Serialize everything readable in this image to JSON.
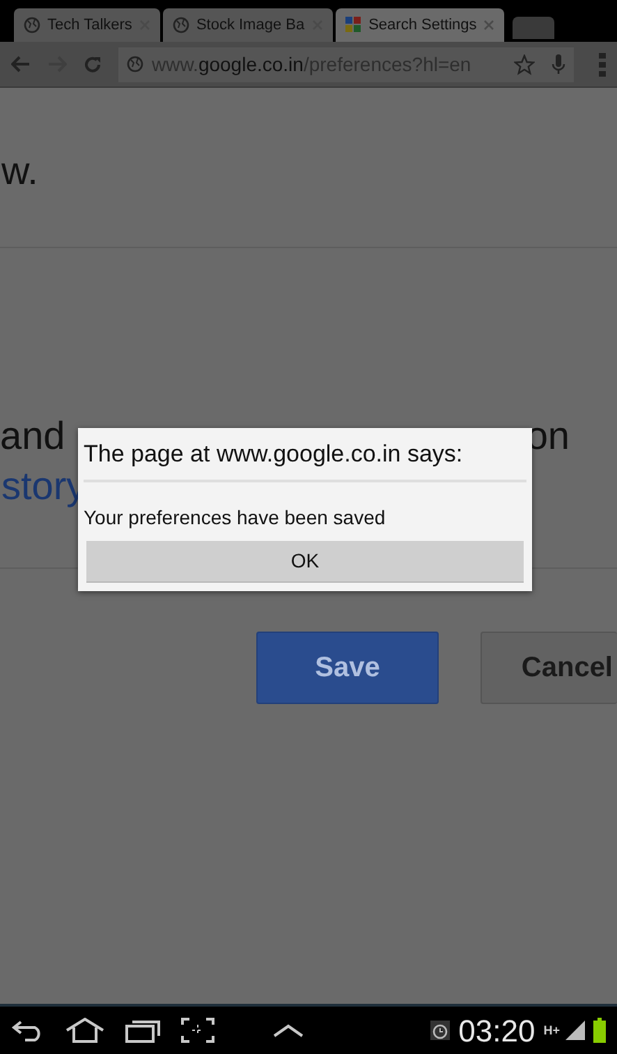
{
  "tabs": [
    {
      "title": "Tech Talkers",
      "selected": false
    },
    {
      "title": "Stock Image Ba",
      "selected": false
    },
    {
      "title": "Search Settings",
      "selected": true
    }
  ],
  "address_bar": {
    "prefix": "www.",
    "domain": "google.co.in",
    "path": "/preferences?hl=en"
  },
  "page": {
    "line_1": "w.",
    "line_2_left": "and",
    "line_2_right": "on",
    "link": "story",
    "buttons": [
      {
        "kind": "primary",
        "label": "Save"
      },
      {
        "kind": "secondary",
        "label": "Cancel"
      }
    ]
  },
  "dialog": {
    "title": "The page at www.google.co.in says:",
    "message": "Your preferences have been saved",
    "button": "OK"
  },
  "status_bar": {
    "time": "03:20",
    "network": "H+"
  }
}
